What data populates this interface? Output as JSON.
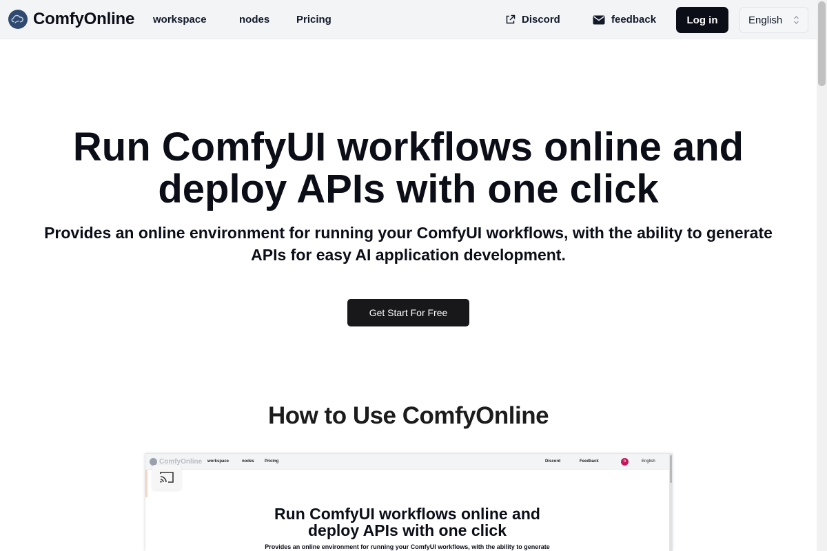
{
  "header": {
    "brand": "ComfyOnline",
    "logo_icon": "cloud-logo-icon",
    "nav": {
      "workspace": "workspace",
      "nodes": "nodes",
      "pricing": "Pricing"
    },
    "discord": {
      "label": "Discord",
      "icon": "external-link-icon"
    },
    "feedback": {
      "label": "feedback",
      "icon": "envelope-icon"
    },
    "login": "Log in",
    "language": {
      "selected": "English",
      "icon": "chevron-up-down-icon"
    }
  },
  "hero": {
    "title_line1": "Run ComfyUI workflows online and",
    "title_line2": "deploy APIs with one click",
    "subtitle_line1": "Provides an online environment for running your ComfyUI workflows, with the ability to generate",
    "subtitle_line2": "APIs for easy AI application development.",
    "cta": "Get Start For Free"
  },
  "howto": {
    "title": "How to Use ComfyOnline"
  },
  "preview": {
    "brand": "ComfyOnline",
    "nav_workspace": "workspace",
    "nav_nodes": "nodes",
    "nav_pricing": "Pricing",
    "discord": "Discord",
    "feedback": "Feedback",
    "avatar": "b",
    "language": "English",
    "cast_icon": "cast-icon",
    "title_line1": "Run ComfyUI workflows online and",
    "title_line2": "deploy APIs with one click",
    "subtitle": "Provides an online environment for running your ComfyUI workflows, with the ability to generate"
  },
  "colors": {
    "header_bg": "#f3f4f6",
    "primary_dark": "#0b0d17",
    "cta_bg": "#18181b",
    "logo_blue": "#2f4a6e"
  }
}
